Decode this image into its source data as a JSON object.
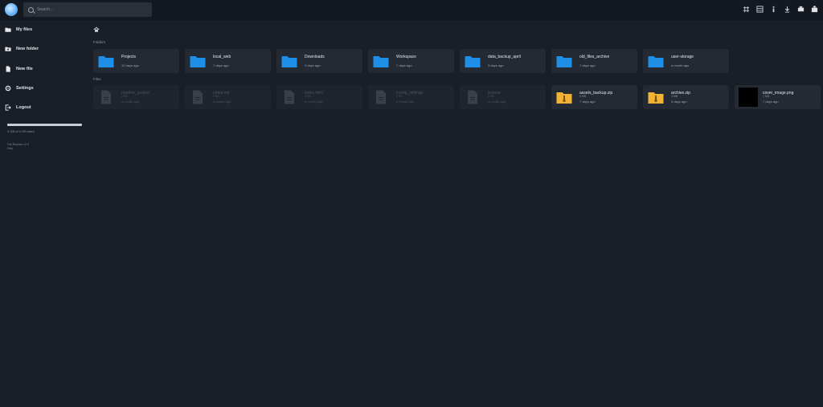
{
  "header": {
    "search_placeholder": "Search...",
    "icons": [
      "grid-view-icon",
      "list-view-icon",
      "info-icon",
      "download-icon",
      "print-icon",
      "upload-icon"
    ]
  },
  "sidebar": {
    "items": [
      {
        "label": "My files",
        "icon": "folder-icon"
      },
      {
        "label": "New folder",
        "icon": "new-folder-icon"
      },
      {
        "label": "New file",
        "icon": "new-file-icon"
      },
      {
        "label": "Settings",
        "icon": "gear-icon"
      },
      {
        "label": "Logout",
        "icon": "logout-icon"
      }
    ],
    "storage_used_fraction": 1.0,
    "storage_text": "4 GB of 4 GB used",
    "version_line1": "File Browser v2.0",
    "version_line2": "Help"
  },
  "main": {
    "folders_label": "Folders",
    "files_label": "Files",
    "folders": [
      {
        "name": "Projects",
        "meta": "12 days ago"
      },
      {
        "name": "local_web",
        "meta": "7 days ago"
      },
      {
        "name": "Downloads",
        "meta": "3 days ago"
      },
      {
        "name": "Workspace",
        "meta": "7 days ago"
      },
      {
        "name": "data_backup_april",
        "meta": "5 days ago"
      },
      {
        "name": "old_files_archive",
        "meta": "7 days ago"
      },
      {
        "name": "user-storage",
        "meta": "a month ago"
      }
    ],
    "files": [
      {
        "name": "readme_project",
        "size": "1 KB",
        "meta": "a month ago",
        "kind": "doc",
        "dim": true
      },
      {
        "name": "notes.md",
        "size": "2 KB",
        "meta": "a month ago",
        "kind": "doc",
        "dim": true
      },
      {
        "name": "index.html",
        "size": "4 KB",
        "meta": "a month ago",
        "kind": "doc",
        "dim": true
      },
      {
        "name": "config_settings",
        "size": "1 KB",
        "meta": "a month ago",
        "kind": "doc",
        "dim": true
      },
      {
        "name": "license",
        "size": "1 KB",
        "meta": "a month ago",
        "kind": "doc",
        "dim": true
      },
      {
        "name": "assets_backup.zip",
        "size": "6 MB",
        "meta": "7 days ago",
        "kind": "zip",
        "dim": false
      },
      {
        "name": "archive.zip",
        "size": "3 MB",
        "meta": "3 days ago",
        "kind": "zip",
        "dim": false
      },
      {
        "name": "cover_image.png",
        "size": "1 MB",
        "meta": "7 days ago",
        "kind": "image",
        "dim": false
      }
    ]
  },
  "colors": {
    "folder": "#1e8ee6",
    "zip": "#f2b233",
    "doc_dim": "#3a4049"
  }
}
